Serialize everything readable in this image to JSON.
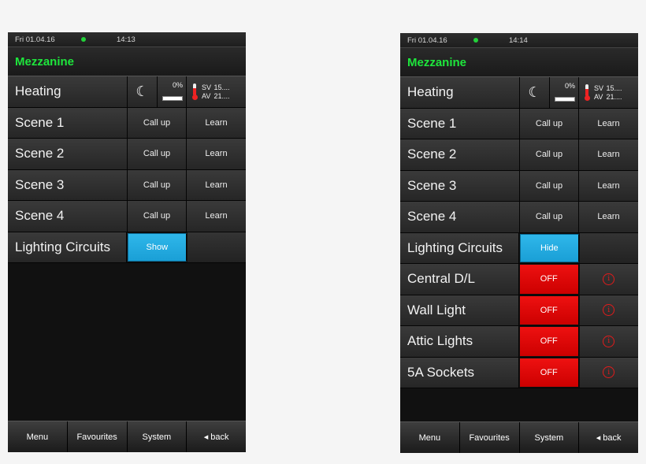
{
  "left": {
    "status": {
      "date": "Fri 01.04.16",
      "time": "14:13"
    },
    "title": "Mezzanine",
    "heating": {
      "label": "Heating",
      "moon_icon": "moon-icon",
      "percent": "0%",
      "sv": "SV",
      "sv_value": "15....",
      "av": "AV",
      "av_value": "21...."
    },
    "scenes": [
      {
        "label": "Scene 1",
        "call": "Call up",
        "learn": "Learn"
      },
      {
        "label": "Scene 2",
        "call": "Call up",
        "learn": "Learn"
      },
      {
        "label": "Scene 3",
        "call": "Call up",
        "learn": "Learn"
      },
      {
        "label": "Scene 4",
        "call": "Call up",
        "learn": "Learn"
      }
    ],
    "lighting": {
      "label": "Lighting Circuits",
      "toggle": "Show"
    },
    "nav": [
      "Menu",
      "Favourites",
      "System",
      "◂ back"
    ]
  },
  "right": {
    "status": {
      "date": "Fri 01.04.16",
      "time": "14:14"
    },
    "title": "Mezzanine",
    "heating": {
      "label": "Heating",
      "moon_icon": "moon-icon",
      "percent": "0%",
      "sv": "SV",
      "sv_value": "15....",
      "av": "AV",
      "av_value": "21...."
    },
    "scenes": [
      {
        "label": "Scene 1",
        "call": "Call up",
        "learn": "Learn"
      },
      {
        "label": "Scene 2",
        "call": "Call up",
        "learn": "Learn"
      },
      {
        "label": "Scene 3",
        "call": "Call up",
        "learn": "Learn"
      },
      {
        "label": "Scene 4",
        "call": "Call up",
        "learn": "Learn"
      }
    ],
    "lighting": {
      "label": "Lighting Circuits",
      "toggle": "Hide"
    },
    "circuits": [
      {
        "label": "Central D/L",
        "state": "OFF"
      },
      {
        "label": "Wall Light",
        "state": "OFF"
      },
      {
        "label": "Attic Lights",
        "state": "OFF"
      },
      {
        "label": "5A Sockets",
        "state": "OFF"
      }
    ],
    "nav": [
      "Menu",
      "Favourites",
      "System",
      "◂ back"
    ]
  },
  "colors": {
    "title_green": "#1ee63c",
    "button_blue": "#1fa8de",
    "off_red": "#e00000",
    "status_led": "#22d13a"
  }
}
